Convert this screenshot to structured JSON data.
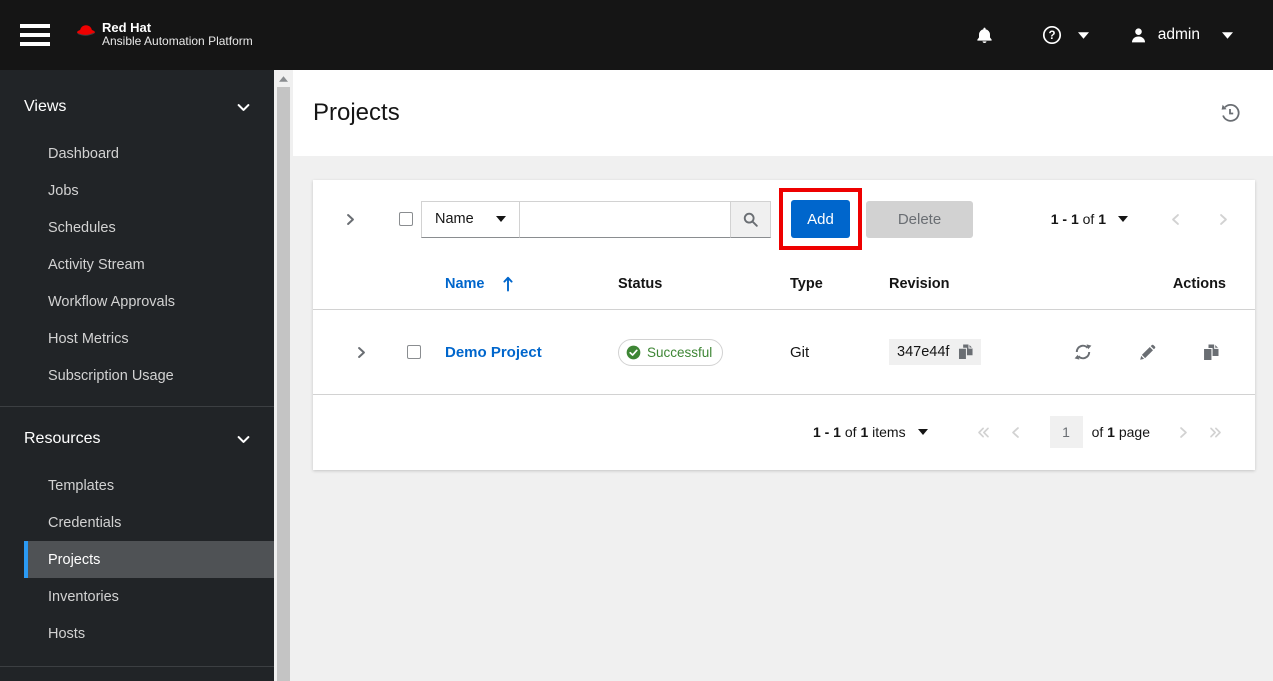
{
  "masthead": {
    "brand_title": "Red Hat",
    "brand_subtitle": "Ansible Automation Platform",
    "user": "admin"
  },
  "sidebar": {
    "groups": [
      {
        "label": "Views",
        "items": [
          "Dashboard",
          "Jobs",
          "Schedules",
          "Activity Stream",
          "Workflow Approvals",
          "Host Metrics",
          "Subscription Usage"
        ]
      },
      {
        "label": "Resources",
        "items": [
          "Templates",
          "Credentials",
          "Projects",
          "Inventories",
          "Hosts"
        ],
        "selected_item": "Projects"
      }
    ]
  },
  "page": {
    "title": "Projects"
  },
  "toolbar": {
    "filter": {
      "selected": "Name"
    },
    "search_value": "",
    "add_label": "Add",
    "delete_label": "Delete"
  },
  "pagination_top": {
    "range": "1 - 1",
    "of_word": "of",
    "total": "1"
  },
  "table": {
    "headers": {
      "name": "Name",
      "status": "Status",
      "type": "Type",
      "revision": "Revision",
      "actions": "Actions"
    },
    "rows": [
      {
        "name": "Demo Project",
        "status": "Successful",
        "type": "Git",
        "revision": "347e44f"
      }
    ]
  },
  "pagination_bottom": {
    "range": "1 - 1",
    "of_word": "of",
    "total": "1",
    "items_word": "items",
    "page_value": "1",
    "page_of_word": "of",
    "page_total": "1",
    "page_word": "page"
  },
  "colors": {
    "masthead_bg": "#151515",
    "sidebar_bg": "#212427",
    "sidebar_selected_bg": "#4f5255",
    "selected_indicator": "#2b9af3",
    "accent_blue": "#0066cc",
    "annotation_red": "#ee0000",
    "success_green": "#3e8635",
    "content_bg": "#f0f0f0",
    "disabled_gray": "#d2d2d2",
    "icon_gray": "#6a6e73"
  },
  "icons": {
    "masthead": [
      "menu-icon",
      "redhat-logo-icon",
      "bell-icon",
      "help-icon",
      "caret-down-icon",
      "user-icon"
    ],
    "page_header": [
      "history-icon"
    ],
    "toolbar": [
      "chevron-right-icon",
      "caret-down-icon",
      "search-icon"
    ],
    "table": [
      "sort-up-icon",
      "check-circle-icon",
      "copy-icon",
      "sync-icon",
      "pencil-icon"
    ],
    "pagination": [
      "angle-left-icon",
      "angle-right-icon",
      "angle-double-left-icon",
      "angle-double-right-icon"
    ]
  }
}
